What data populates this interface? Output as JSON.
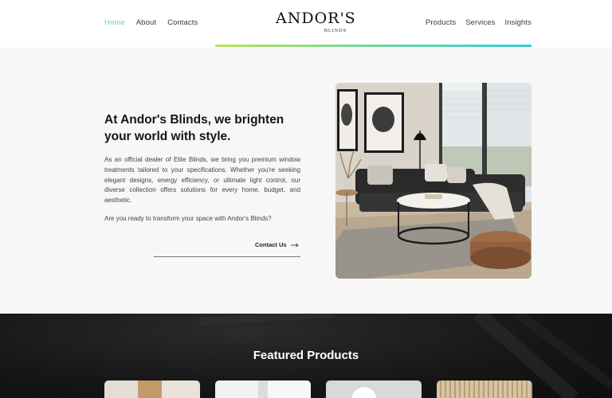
{
  "nav": {
    "left": [
      {
        "label": "Home",
        "active": true
      },
      {
        "label": "About"
      },
      {
        "label": "Contacts"
      }
    ],
    "right": [
      {
        "label": "Products"
      },
      {
        "label": "Services"
      },
      {
        "label": "Insights"
      }
    ]
  },
  "logo": {
    "main": "ANDOR'S",
    "sub": "BLINDS"
  },
  "hero": {
    "title": "At Andor's Blinds, we brighten your world with style.",
    "body": "As an official dealer of Elite Blinds, we bring you premium window treatments tailored to your specifications. Whether you're seeking elegant designs, energy efficiency, or ultimate light control, our diverse collection offers solutions for every home, budget, and aesthetic.",
    "question": "Are you ready to transform your space with Andor's Blinds?",
    "cta": "Contact Us"
  },
  "featured": {
    "title": "Featured Products"
  },
  "colors": {
    "nav_active": "#7ec5bd",
    "accent_gradient_start": "#b5e35c",
    "accent_gradient_end": "#2ecfd8",
    "dark_section": "#161616"
  }
}
